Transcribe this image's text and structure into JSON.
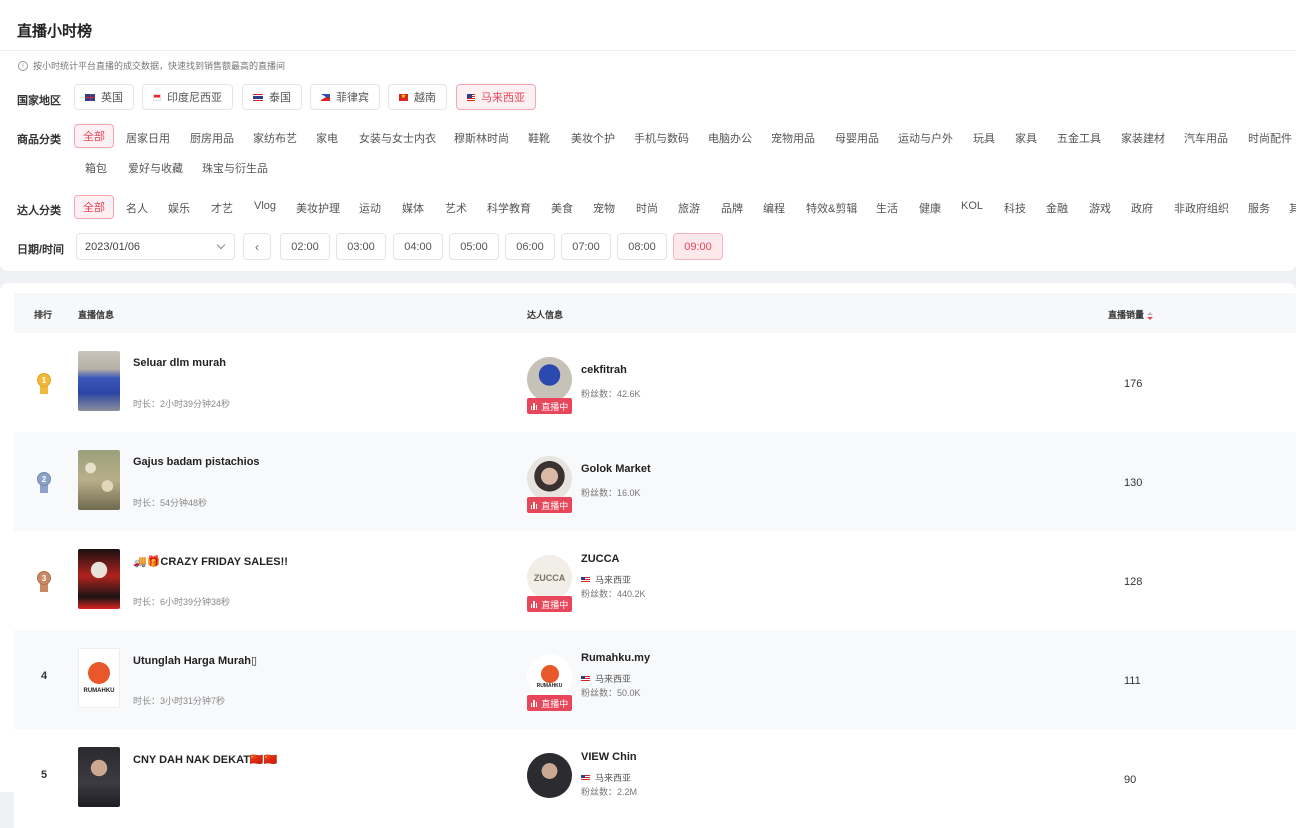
{
  "page": {
    "title": "直播小时榜",
    "tip": "按小时统计平台直播的成交数据，快速找到销售额最高的直播间"
  },
  "region": {
    "label": "国家地区",
    "items": [
      {
        "label": "英国",
        "flag": "uk"
      },
      {
        "label": "印度尼西亚",
        "flag": "id"
      },
      {
        "label": "泰国",
        "flag": "th"
      },
      {
        "label": "菲律宾",
        "flag": "ph"
      },
      {
        "label": "越南",
        "flag": "vn"
      },
      {
        "label": "马来西亚",
        "flag": "my",
        "active": true
      }
    ]
  },
  "category": {
    "label": "商品分类",
    "items": [
      "全部",
      "居家日用",
      "厨房用品",
      "家纺布艺",
      "家电",
      "女装与女士内衣",
      "穆斯林时尚",
      "鞋靴",
      "美妆个护",
      "手机与数码",
      "电脑办公",
      "宠物用品",
      "母婴用品",
      "运动与户外",
      "玩具",
      "家具",
      "五金工具",
      "家装建材",
      "汽车用品",
      "时尚配件",
      "箱包",
      "爱好与收藏",
      "珠宝与衍生品"
    ]
  },
  "influencer": {
    "label": "达人分类",
    "items": [
      "全部",
      "名人",
      "娱乐",
      "才艺",
      "Vlog",
      "美妆护理",
      "运动",
      "媒体",
      "艺术",
      "科学教育",
      "美食",
      "宠物",
      "时尚",
      "旅游",
      "品牌",
      "编程",
      "特效&剪辑",
      "生活",
      "健康",
      "KOL",
      "科技",
      "金融",
      "游戏",
      "政府",
      "非政府组织",
      "服务",
      "其"
    ]
  },
  "datetime": {
    "label": "日期/时间",
    "date": "2023/01/06",
    "prev": "‹",
    "hours": [
      "02:00",
      "03:00",
      "04:00",
      "05:00",
      "06:00",
      "07:00",
      "08:00",
      "09:00"
    ],
    "active_hour": "09:00"
  },
  "table": {
    "headers": {
      "rank": "排行",
      "live": "直播信息",
      "kol": "达人信息",
      "sales": "直播销量"
    },
    "live_badge": "直播中",
    "rows": [
      {
        "rank": "1",
        "title": "Seluar dlm murah",
        "duration": "时长：2小时39分钟24秒",
        "kol": "cekfitrah",
        "country": "",
        "fans": "粉丝数：42.6K",
        "sales": "176"
      },
      {
        "rank": "2",
        "title": "Gajus badam pistachios",
        "duration": "时长：54分钟48秒",
        "kol": "Golok Market",
        "country": "",
        "fans": "粉丝数：16.0K",
        "sales": "130"
      },
      {
        "rank": "3",
        "title": "🚚🎁CRAZY FRIDAY SALES!!",
        "duration": "时长：6小时39分钟38秒",
        "kol": "ZUCCA",
        "country": "马来西亚",
        "fans": "粉丝数：440.2K",
        "sales": "128"
      },
      {
        "rank": "4",
        "title": "Utunglah Harga Murah▯",
        "duration": "时长：3小时31分钟7秒",
        "kol": "Rumahku.my",
        "country": "马来西亚",
        "fans": "粉丝数：50.0K",
        "sales": "111"
      },
      {
        "rank": "5",
        "title": "CNY DAH NAK DEKAT🇨🇳🇨🇳",
        "duration": "",
        "kol": "VIEW Chin",
        "country": "马来西亚",
        "fans": "粉丝数：2.2M",
        "sales": "90"
      }
    ]
  },
  "colors": {
    "accent": "#e8465a",
    "gold": "#f0b93a",
    "silver": "#8da2c8",
    "bronze": "#c98a63"
  }
}
